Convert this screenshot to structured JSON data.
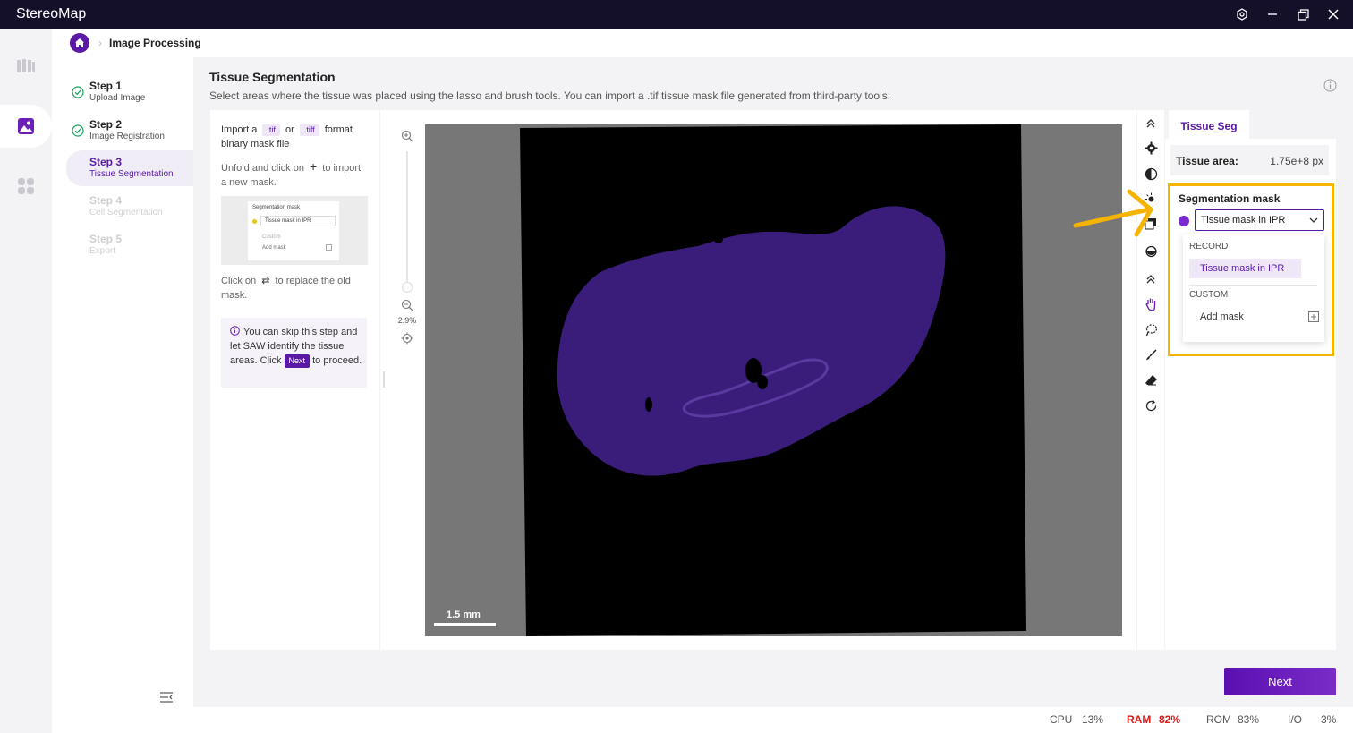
{
  "app": {
    "title": "StereoMap"
  },
  "breadcrumb": {
    "current": "Image Processing"
  },
  "steps": [
    {
      "title": "Step 1",
      "subtitle": "Upload Image",
      "state": "done"
    },
    {
      "title": "Step 2",
      "subtitle": "Image Registration",
      "state": "done"
    },
    {
      "title": "Step 3",
      "subtitle": "Tissue Segmentation",
      "state": "current"
    },
    {
      "title": "Step 4",
      "subtitle": "Cell Segmentation",
      "state": "disabled"
    },
    {
      "title": "Step 5",
      "subtitle": "Export",
      "state": "disabled"
    }
  ],
  "page": {
    "title": "Tissue Segmentation",
    "description": "Select areas where the tissue was placed using the lasso and brush tools. You can import a .tif tissue mask file generated from third-party tools."
  },
  "instructions": {
    "import_prefix": "Import a",
    "tif": ".tif",
    "or": "or",
    "tiff": ".tiff",
    "format": "format",
    "binary_line": "binary mask file",
    "unfold_prefix": "Unfold and click on",
    "unfold_suffix": "to import",
    "unfold_line2": "a new mask.",
    "replace_prefix": "Click on",
    "replace_suffix": "to replace the old",
    "replace_line2": "mask.",
    "tip_text": "You can skip this step and let SAW identify the tissue areas. Click",
    "tip_next": "Next",
    "tip_end": "to proceed.",
    "mini": {
      "title": "Segmentation mask",
      "selected": "Tissue mask in IPR",
      "custom": "Custom",
      "add": "Add mask"
    }
  },
  "viewer": {
    "zoom": "2.9%",
    "scalebar": "1.5 mm"
  },
  "right_panel": {
    "tab": "Tissue Seg",
    "tissue_area_label": "Tissue area:",
    "tissue_area_value": "1.75e+8 px",
    "seg_title": "Segmentation mask",
    "selected": "Tissue mask in IPR",
    "record_label": "RECORD",
    "record_item": "Tissue mask in IPR",
    "custom_label": "CUSTOM",
    "add_mask": "Add mask"
  },
  "next_button": "Next",
  "status": {
    "cpu_label": "CPU",
    "cpu_value": "13%",
    "ram_label": "RAM",
    "ram_value": "82%",
    "rom_label": "ROM",
    "rom_value": "83%",
    "io_label": "I/O",
    "io_value": "3%"
  },
  "colors": {
    "accent": "#5a1aa6",
    "highlight": "#f5b400",
    "titlebar": "#14102a",
    "tissue": "#3a1d7a"
  }
}
